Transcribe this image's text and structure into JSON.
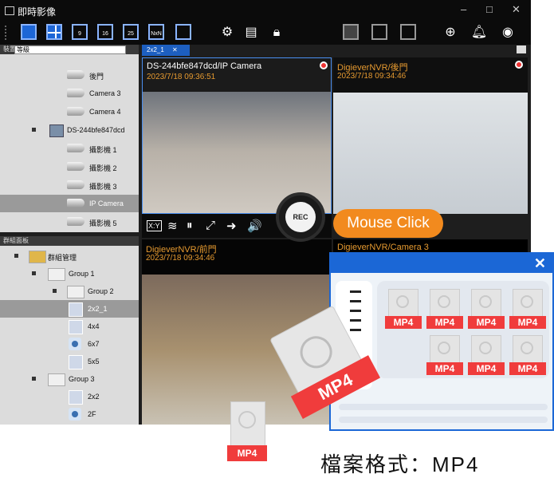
{
  "window": {
    "title": "即時影像",
    "min": "–",
    "max": "□",
    "close": "✕"
  },
  "toolbar": {
    "layouts": [
      "",
      "",
      "9",
      "16",
      "25",
      "NxN",
      ""
    ]
  },
  "device_panel": {
    "title": "裝置面板",
    "selector": "等級",
    "items": [
      {
        "label": "後門",
        "type": "camera"
      },
      {
        "label": "Camera 3",
        "type": "camera"
      },
      {
        "label": "Camera 4",
        "type": "camera"
      },
      {
        "label": "DS-244bfe847dcd",
        "type": "nvr"
      },
      {
        "label": "攝影機 1",
        "type": "camera"
      },
      {
        "label": "攝影機 2",
        "type": "camera"
      },
      {
        "label": "攝影機 3",
        "type": "camera"
      },
      {
        "label": "IP Camera",
        "type": "camera",
        "selected": true
      },
      {
        "label": "攝影機 5",
        "type": "camera"
      }
    ]
  },
  "group_panel": {
    "title": "群組面板",
    "items": [
      {
        "label": "群組管理",
        "type": "root"
      },
      {
        "label": "Group 1",
        "type": "folder"
      },
      {
        "label": "Group 2",
        "type": "folder"
      },
      {
        "label": "2x2_1",
        "type": "grid",
        "selected": true
      },
      {
        "label": "4x4",
        "type": "grid"
      },
      {
        "label": "6x7",
        "type": "dome"
      },
      {
        "label": "5x5",
        "type": "grid"
      },
      {
        "label": "Group 3",
        "type": "folder"
      },
      {
        "label": "2x2",
        "type": "grid"
      },
      {
        "label": "2F",
        "type": "dome"
      }
    ]
  },
  "view_tab": {
    "label": "2x2_1",
    "close": "✕"
  },
  "channels": [
    {
      "name": "DS-244bfe847dcd/IP Camera",
      "time": "2023/7/18 09:36:51"
    },
    {
      "name": "DigieverNVR/後門",
      "time": "2023/7/18 09:34:46"
    },
    {
      "name": "DigieverNVR/前門",
      "time": "2023/7/18 09:34:46"
    },
    {
      "name": "DigieverNVR/Camera 3",
      "time": ""
    }
  ],
  "playback_bar": {
    "icons": [
      "X:Y",
      "≋",
      "⏸",
      "⤢",
      "➜",
      "🔊"
    ]
  },
  "rec_button": "REC",
  "mouse_click": "Mouse Click",
  "export_dialog": {
    "close": "✕",
    "file_label": "MP4"
  },
  "big_file_label": "MP4",
  "small_file_label": "MP4",
  "caption": "檔案格式：MP4"
}
